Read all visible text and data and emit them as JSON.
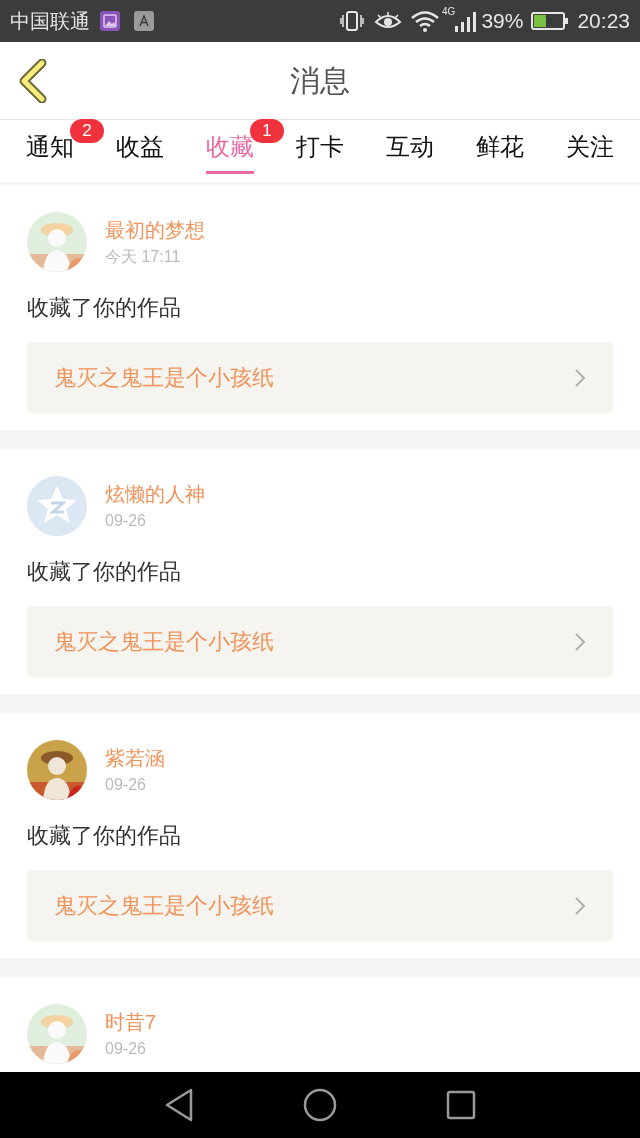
{
  "status_bar": {
    "carrier": "中国联通",
    "network": "4G",
    "battery": "39%",
    "time": "20:23"
  },
  "header": {
    "title": "消息"
  },
  "tabs": [
    {
      "label": "通知",
      "selected": false,
      "badge": "2"
    },
    {
      "label": "收益",
      "selected": false
    },
    {
      "label": "收藏",
      "selected": true,
      "badge": "1"
    },
    {
      "label": "打卡",
      "selected": false
    },
    {
      "label": "互动",
      "selected": false
    },
    {
      "label": "鲜花",
      "selected": false
    },
    {
      "label": "关注",
      "selected": false
    }
  ],
  "messages": [
    {
      "name": "最初的梦想",
      "time": "今天 17:11",
      "action": "收藏了你的作品",
      "work": "鬼灭之鬼王是个小孩纸"
    },
    {
      "avatar": {
        "kind": "default"
      },
      "name": "炫懒的人神",
      "time": "09-26",
      "action": "收藏了你的作品",
      "work": "鬼灭之鬼王是个小孩纸"
    },
    {
      "name": "紫若涵",
      "time": "09-26",
      "action": "收藏了你的作品",
      "work": "鬼灭之鬼王是个小孩纸"
    },
    {
      "name": "时昔7",
      "time": "09-26"
    }
  ]
}
